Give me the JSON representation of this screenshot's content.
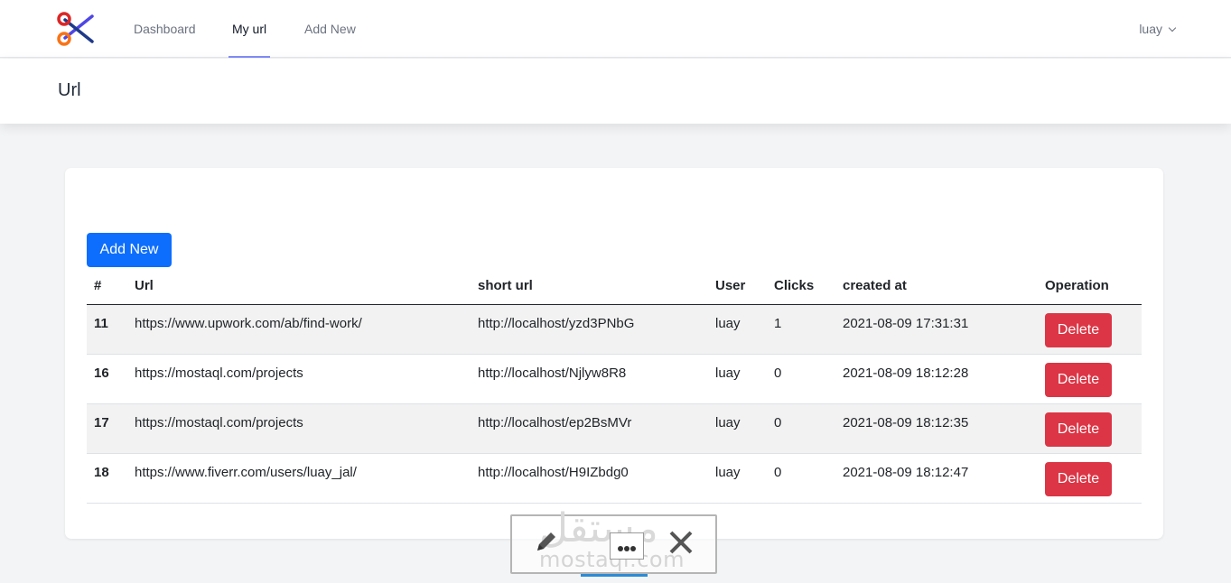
{
  "nav": {
    "links": [
      "Dashboard",
      "My url",
      "Add New"
    ],
    "active": "My url",
    "user": "luay"
  },
  "header": {
    "title": "Url"
  },
  "main": {
    "add_button": "Add New",
    "columns": [
      "#",
      "Url",
      "short url",
      "User",
      "Clicks",
      "created at",
      "Operation"
    ],
    "rows": [
      {
        "id": "11",
        "url": "https://www.upwork.com/ab/find-work/",
        "short": "http://localhost/yzd3PNbG",
        "user": "luay",
        "clicks": "1",
        "created": "2021-08-09 17:31:31",
        "action": "Delete"
      },
      {
        "id": "16",
        "url": "https://mostaql.com/projects",
        "short": "http://localhost/Njlyw8R8",
        "user": "luay",
        "clicks": "0",
        "created": "2021-08-09 18:12:28",
        "action": "Delete"
      },
      {
        "id": "17",
        "url": "https://mostaql.com/projects",
        "short": "http://localhost/ep2BsMVr",
        "user": "luay",
        "clicks": "0",
        "created": "2021-08-09 18:12:35",
        "action": "Delete"
      },
      {
        "id": "18",
        "url": "https://www.fiverr.com/users/luay_jal/",
        "short": "http://localhost/H9IZbdg0",
        "user": "luay",
        "clicks": "0",
        "created": "2021-08-09 18:12:47",
        "action": "Delete"
      }
    ]
  },
  "watermark": {
    "text": "mostaql.com",
    "arabic": "مستقل"
  },
  "colors": {
    "primary": "#0d6efd",
    "danger": "#dc3545",
    "nav_active_underline": "#818cf8"
  },
  "icons": [
    "scissors-logo-icon",
    "chevron-down-icon",
    "pencil-icon",
    "more-dots-icon",
    "close-icon"
  ]
}
